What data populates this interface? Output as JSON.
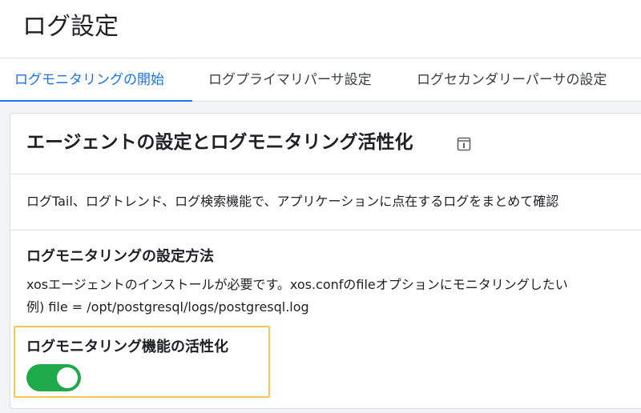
{
  "header": {
    "title": "ログ設定"
  },
  "tabs": [
    {
      "label": "ログモニタリングの開始",
      "active": true
    },
    {
      "label": "ログプライマリパーサ設定",
      "active": false
    },
    {
      "label": "ログセカンダリーパーサの設定",
      "active": false
    }
  ],
  "card": {
    "title": "エージェントの設定とログモニタリング活性化",
    "info_icon": "info-icon",
    "description": "ログTail、ログトレンド、ログ検索機能で、アプリケーションに点在するログをまとめて確認",
    "setup": {
      "title": "ログモニタリングの設定方法",
      "line1": "xosエージェントのインストールが必要です。xos.confのfileオプションにモニタリングしたい",
      "line2": "例) file = /opt/postgresql/logs/postgresql.log"
    },
    "activation": {
      "label": "ログモニタリング機能の活性化",
      "enabled": true
    }
  },
  "colors": {
    "accent": "#1a73e8",
    "toggle_on": "#1eaa4b",
    "highlight": "#f9c74f"
  }
}
